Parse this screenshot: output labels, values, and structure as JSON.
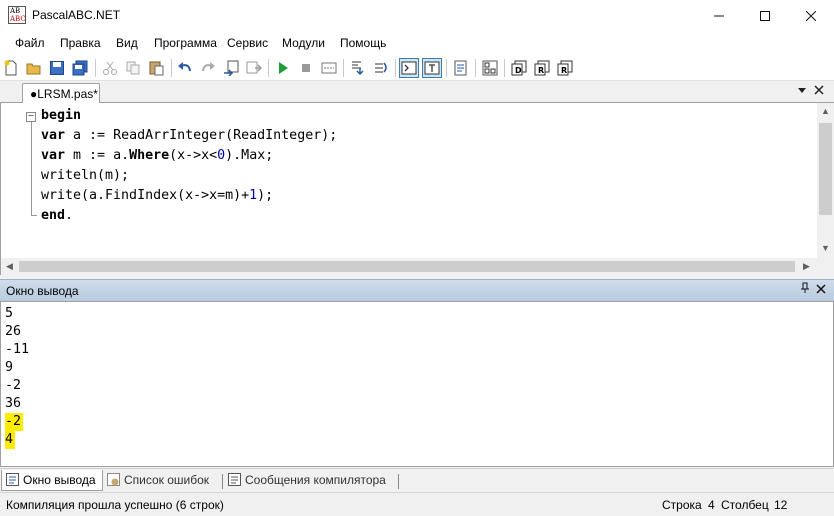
{
  "window": {
    "title": "PascalABC.NET",
    "icon_letters": [
      "AB",
      "ABC"
    ],
    "controls": [
      "minimize",
      "maximize",
      "close"
    ]
  },
  "menu": [
    "Файл",
    "Правка",
    "Вид",
    "Программа",
    "Сервис",
    "Модули",
    "Помощь"
  ],
  "toolbar": {
    "buttons": [
      "new-file-icon",
      "open-folder-icon",
      "save-icon",
      "save-all-icon",
      "cut-icon",
      "copy-icon",
      "paste-icon",
      "undo-icon",
      "redo-icon",
      "format-code-icon",
      "compile-icon",
      "run-icon",
      "stop-icon",
      "step-icon",
      "debug-step-into-icon",
      "debug-step-over-icon",
      "console-icon",
      "text-icon",
      "properties-icon",
      "references-icon",
      "form-designer-icon",
      "debug-icon",
      "release-icon"
    ]
  },
  "editor": {
    "tab_label": "●LRSM.pas*",
    "lines": [
      [
        [
          "begin",
          "kw"
        ]
      ],
      [
        [
          "var",
          "kw"
        ],
        [
          " a := ReadArrInteger(ReadInteger);",
          ""
        ]
      ],
      [
        [
          "var",
          "kw"
        ],
        [
          " m := a.",
          ""
        ],
        [
          "Where",
          "kw"
        ],
        [
          "(x->x<",
          ""
        ],
        [
          "0",
          "num"
        ],
        [
          ").Max;",
          ""
        ]
      ],
      [
        [
          "writeln(m);",
          ""
        ]
      ],
      [
        [
          "write(a.FindIndex(x->x=m)+",
          ""
        ],
        [
          "1",
          "num"
        ],
        [
          ");",
          ""
        ]
      ],
      [
        [
          "end",
          "kw"
        ],
        [
          ".",
          ""
        ]
      ]
    ]
  },
  "output_panel": {
    "title": "Окно вывода",
    "lines": [
      "5",
      "26",
      "-11",
      "9",
      "-2",
      "36",
      "-2",
      "4"
    ],
    "highlighted_from_index": 6,
    "highlight_color": "#ffec00"
  },
  "bottom_tabs": [
    "Окно вывода",
    "Список ошибок",
    "Сообщения компилятора"
  ],
  "status": {
    "message": "Компиляция прошла успешно (6 строк)",
    "line_label": "Строка",
    "line_value": "4",
    "column_label": "Столбец",
    "column_value": "12"
  },
  "colors": {
    "panel_header": "#b8cbe0",
    "highlight": "#ffec00",
    "active_tool_border": "#3c7fb1"
  }
}
